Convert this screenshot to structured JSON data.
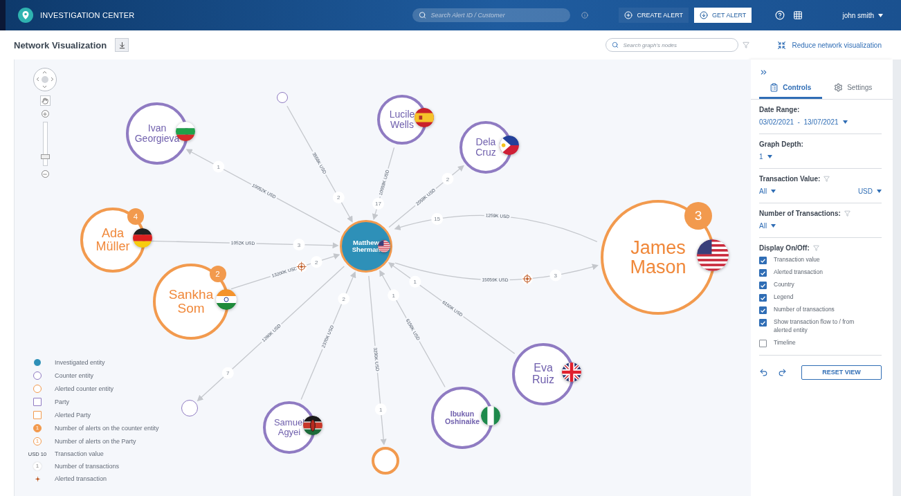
{
  "header": {
    "app_title": "INVESTIGATION CENTER",
    "search": {
      "placeholder": "Search Alert ID / Customer"
    },
    "create_button": "CREATE ALERT",
    "get_button": "GET ALERT",
    "user": "john smith"
  },
  "toolbar": {
    "title": "Network Visualization",
    "node_search": {
      "placeholder": "Search graph's nodes"
    },
    "reduce_link": "Reduce network visualization"
  },
  "zoom": {
    "level": 0.2
  },
  "investigated": {
    "name": "Matthew Sherman",
    "flag": {
      "kind": "us"
    }
  },
  "nodes": [
    {
      "name": "Ivan Georgieva",
      "kind": "counter",
      "flag": {
        "kind": "bg"
      },
      "edges": [
        {
          "amount": "10052K USD",
          "count": "1",
          "outgoing": true,
          "alerted": false
        }
      ]
    },
    {
      "kind": "counter",
      "edges": [
        {
          "amount": "3559K USD",
          "count": "2",
          "outgoing": false,
          "alerted": false
        }
      ]
    },
    {
      "name": "Lucile Wells",
      "kind": "counter",
      "flag": {
        "kind": "es"
      },
      "edges": [
        {
          "amount": "10059K USD",
          "count": "17",
          "outgoing": false,
          "alerted": false
        }
      ]
    },
    {
      "name": "Dela Cruz",
      "kind": "counter",
      "flag": {
        "kind": "ph"
      },
      "edges": [
        {
          "amount": "2059K USD",
          "count": "2",
          "outgoing": true,
          "alerted": false
        }
      ]
    },
    {
      "name": "Ada Müller",
      "kind": "alerted",
      "alerts": "4",
      "flag": {
        "kind": "de"
      },
      "edges": [
        {
          "amount": "1052K USD",
          "count": "3",
          "outgoing": false,
          "alerted": false
        }
      ]
    },
    {
      "name": "Sankha Som",
      "kind": "alerted",
      "alerts": "2",
      "flag": {
        "kind": "in"
      },
      "edges": [
        {
          "amount": "13200K USD",
          "count": "2",
          "outgoing": false,
          "alerted": true
        }
      ]
    },
    {
      "name": "James Mason",
      "kind": "alerted",
      "alerts": "3",
      "flag": {
        "kind": "us"
      },
      "edges": [
        {
          "amount": "1259K USD",
          "count": "15",
          "outgoing": false,
          "alerted": false
        },
        {
          "amount": "15059K USD",
          "count": "3",
          "outgoing": true,
          "alerted": true
        }
      ]
    },
    {
      "name": "Eva Ruiz",
      "kind": "counter",
      "flag": {
        "kind": "gb"
      },
      "edges": [
        {
          "amount": "6150K USD",
          "count": "1",
          "outgoing": false,
          "alerted": false
        }
      ]
    },
    {
      "name": "Ibukun Oshinaike",
      "kind": "counter",
      "flag": {
        "kind": "ng"
      },
      "edges": [
        {
          "amount": "6150K USD",
          "count": "1",
          "outgoing": false,
          "alerted": false
        }
      ]
    },
    {
      "name": "Samuel Agyei",
      "kind": "counter",
      "flag": {
        "kind": "ke"
      },
      "edges": [
        {
          "amount": "2370K USD",
          "count": "2",
          "outgoing": false,
          "alerted": false
        }
      ]
    },
    {
      "kind": "alerted",
      "edges": [
        {
          "amount": "3290K USD",
          "count": "1",
          "outgoing": true,
          "alerted": false
        }
      ]
    },
    {
      "kind": "counter",
      "edges": [
        {
          "amount": "1280K USD",
          "count": "7",
          "outgoing": true,
          "alerted": false
        }
      ]
    }
  ],
  "legend": [
    {
      "kind": "investigated",
      "label": "Investigated entity"
    },
    {
      "kind": "counter",
      "label": "Counter entity"
    },
    {
      "kind": "alerted",
      "label": "Alerted counter entity"
    },
    {
      "kind": "party",
      "label": "Party"
    },
    {
      "kind": "alerted-party",
      "label": "Alerted Party"
    },
    {
      "kind": "alert-count",
      "symbol": "1",
      "label": "Number of alerts on the counter entity"
    },
    {
      "kind": "party-alert-count",
      "symbol": "1",
      "label": "Number of alerts on the Party"
    },
    {
      "kind": "value",
      "symbol": "USD 10",
      "label": "Transaction value"
    },
    {
      "kind": "count",
      "symbol": "1",
      "label": "Number of transactions"
    },
    {
      "kind": "alerted-tx",
      "label": "Alerted transaction"
    }
  ],
  "panel": {
    "tabs": [
      {
        "label": "Controls",
        "kind": "controls",
        "selected": true
      },
      {
        "label": "Settings",
        "kind": "settings",
        "selected": false
      }
    ],
    "date_range": {
      "label": "Date Range:",
      "value": "03/02/2021  -  13/07/2021"
    },
    "graph_depth": {
      "label": "Graph Depth:",
      "value": "1"
    },
    "transaction_value": {
      "label": "Transaction Value:",
      "value": "All",
      "currency": "USD"
    },
    "transaction_count": {
      "label": "Number of Transactions:",
      "value": "All"
    },
    "display": {
      "label": "Display On/Off:",
      "items": [
        {
          "label": "Transaction value",
          "checked": true
        },
        {
          "label": "Alerted transaction",
          "checked": true
        },
        {
          "label": "Country",
          "checked": true
        },
        {
          "label": "Legend",
          "checked": true
        },
        {
          "label": "Number of transactions",
          "checked": true
        },
        {
          "label": "Show transaction flow to / from alerted entity",
          "checked": true
        },
        {
          "label": "Timeline",
          "checked": false
        }
      ]
    },
    "reset_button": "RESET VIEW"
  }
}
